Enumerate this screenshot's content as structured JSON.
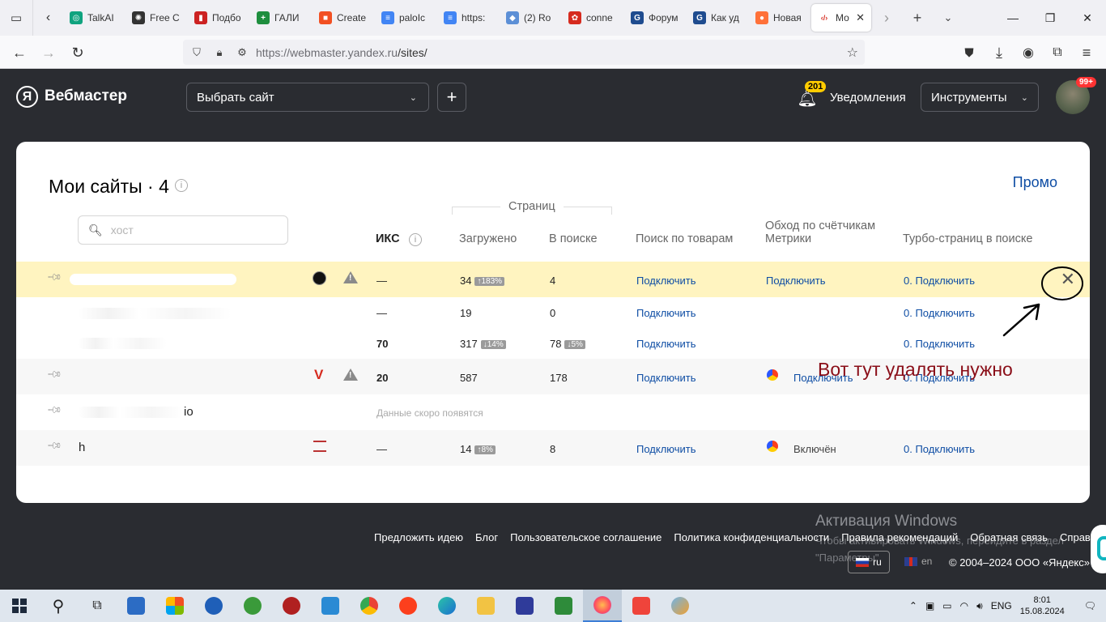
{
  "browser": {
    "tabs": [
      {
        "label": "TalkAI",
        "color": "#10a37f",
        "glyph": "◎"
      },
      {
        "label": "Free C",
        "color": "#333333",
        "glyph": "✺"
      },
      {
        "label": "Подбо",
        "color": "#cc2222",
        "glyph": "▮"
      },
      {
        "label": "ГАЛИ",
        "color": "#1e8e3e",
        "glyph": "+"
      },
      {
        "label": "Create",
        "color": "#f25022",
        "glyph": "■"
      },
      {
        "label": "paloIc",
        "color": "#4285f4",
        "glyph": "≡"
      },
      {
        "label": "https:",
        "color": "#4285f4",
        "glyph": "≡"
      },
      {
        "label": "(2) Ro",
        "color": "#5c8fd6",
        "glyph": "◆"
      },
      {
        "label": "conne",
        "color": "#d62b1f",
        "glyph": "✿"
      },
      {
        "label": "Форум",
        "color": "#1f4c8f",
        "glyph": "G"
      },
      {
        "label": "Как уд",
        "color": "#1f4c8f",
        "glyph": "G"
      },
      {
        "label": "Новая",
        "color": "#ff7139",
        "glyph": "●"
      }
    ],
    "active_tab": {
      "label": "Мо",
      "glyph": "‹/›"
    },
    "url_host": "https://webmaster.yandex.ru",
    "url_path": "/sites/"
  },
  "header": {
    "logo_letter": "Я",
    "title": "Вебмастер",
    "site_select": "Выбрать сайт",
    "add_label": "+",
    "notif_count": "201",
    "notif_label": "Уведомления",
    "tools_label": "Инструменты",
    "avatar_badge": "99+"
  },
  "main": {
    "title": "Мои сайты · 4",
    "promo": "Промо",
    "search_placeholder": "хост",
    "columns": {
      "iks": "ИКС",
      "pages_group": "Страниц",
      "loaded": "Загружено",
      "in_search": "В поиске",
      "goods": "Поиск по товарам",
      "metrika": "Обход по счётчикам Метрики",
      "turbo": "Турбо-страниц в поиске"
    },
    "rows": [
      {
        "iks": "—",
        "loaded": "34",
        "loaded_delta": "↑183%",
        "in_search": "4",
        "goods": "Подключить",
        "metrika": "Подключить",
        "turbo": "0. Подключить"
      },
      {
        "iks": "—",
        "loaded": "19",
        "in_search": "0",
        "goods": "Подключить",
        "turbo": "0. Подключить"
      },
      {
        "iks": "70",
        "loaded": "317",
        "loaded_delta": "↓14%",
        "in_search": "78",
        "in_search_delta": "↓5%",
        "goods": "Подключить",
        "turbo": "0. Подключить"
      },
      {
        "iks": "20",
        "loaded": "587",
        "in_search": "178",
        "goods": "Подключить",
        "metrika": "Подключить",
        "turbo": "0. Подключить"
      },
      {
        "site_tail": "io",
        "pending": "Данные скоро появятся"
      },
      {
        "site_head": "h",
        "iks": "—",
        "loaded": "14",
        "loaded_delta": "↑8%",
        "in_search": "8",
        "goods": "Подключить",
        "metrika": "Включён",
        "turbo": "0. Подключить"
      }
    ]
  },
  "annotation": {
    "text": "Вот тут удалять нужно"
  },
  "footer": {
    "links": [
      "Предложить идею",
      "Блог",
      "Пользовательское соглашение",
      "Политика конфиденциальности",
      "Правила рекомендаций",
      "Обратная связь",
      "Справка"
    ],
    "lang_ru": "ru",
    "lang_en": "en",
    "copyright": "© 2004–2024 ООО «Яндекс»",
    "win_activate_title": "Активация Windows",
    "win_activate_text": "Чтобы активировать Windows, перейдите в раздел \"Параметры\"."
  },
  "taskbar": {
    "lang": "ENG",
    "time": "8:01",
    "date": "15.08.2024"
  }
}
